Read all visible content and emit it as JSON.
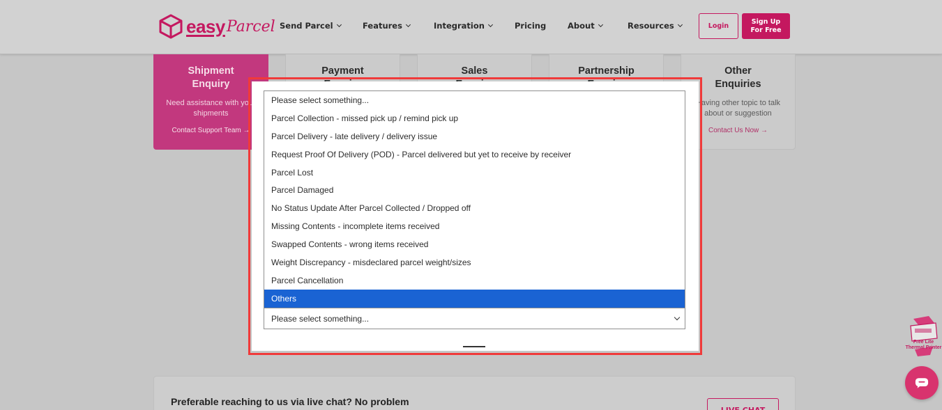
{
  "brand": {
    "word": "easy",
    "script": "Parcel",
    "accent": "#c4185f"
  },
  "nav": {
    "items": [
      {
        "label": "Send Parcel",
        "dropdown": true
      },
      {
        "label": "Features",
        "dropdown": true
      },
      {
        "label": "Integration",
        "dropdown": true
      },
      {
        "label": "Pricing",
        "dropdown": false
      },
      {
        "label": "About",
        "dropdown": true
      },
      {
        "label": "Resources",
        "dropdown": true
      }
    ],
    "login_label": "Login",
    "signup_label": "Sign Up\nFor Free"
  },
  "cards": [
    {
      "title": "Shipment\nEnquiry",
      "desc": "Need assistance with your\nshipments",
      "link": "Contact Support Team →",
      "active": true
    },
    {
      "title": "Payment\nEnquiry",
      "desc": "",
      "link": "",
      "active": false
    },
    {
      "title": "Sales\nEnquiry",
      "desc": "",
      "link": "",
      "active": false
    },
    {
      "title": "Partnership\nEnquiry",
      "desc": "",
      "link": "",
      "active": false
    },
    {
      "title": "Other\nEnquiries",
      "desc": "Having other topic to talk\nabout or suggestion",
      "link": "Contact Us Now →",
      "active": false
    }
  ],
  "dropdown": {
    "options": [
      "Please select something...",
      "Parcel Collection - missed pick up / remind pick up",
      "Parcel Delivery - late delivery / delivery issue",
      "Request Proof Of Delivery (POD) - Parcel delivered but yet to receive by receiver",
      "Parcel Lost",
      "Parcel Damaged",
      "No Status Update After Parcel Collected / Dropped off",
      "Missing Contents - incomplete items received",
      "Swapped Contents - wrong items received",
      "Weight Discrepancy - misdeclared parcel weight/sizes",
      "Parcel Cancellation",
      "Others"
    ],
    "highlighted_index": 11,
    "selected_value": "Please select something..."
  },
  "live_chat": {
    "text": "Preferable reaching to us via live chat? No problem",
    "button_label": "LIVE CHAT"
  },
  "widgets": {
    "printer_label": "Free Lite\nThermal Printer",
    "chat_icon": "chat-bubble-icon"
  }
}
